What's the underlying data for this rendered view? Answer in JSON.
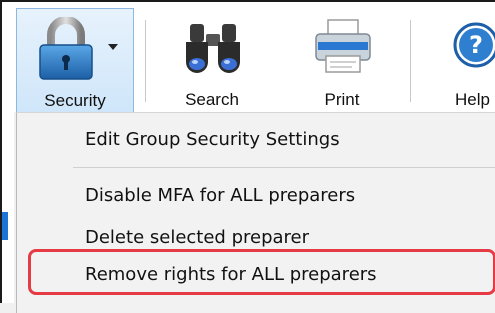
{
  "toolbar": {
    "buttons": [
      {
        "label": "Security",
        "icon": "padlock-icon"
      },
      {
        "label": "Search",
        "icon": "binoculars-icon"
      },
      {
        "label": "Print",
        "icon": "printer-icon"
      },
      {
        "label": "Help",
        "icon": "help-icon"
      }
    ]
  },
  "security_menu": {
    "items": [
      {
        "label": "Edit Group Security Settings"
      },
      {
        "label": "Disable MFA for ALL preparers"
      },
      {
        "label": "Delete selected preparer"
      },
      {
        "label": "Remove rights for ALL preparers"
      }
    ]
  },
  "colors": {
    "highlight": "#e53b45",
    "selected_button": "#cfe6fa",
    "icon_blue": "#2a6fb0"
  }
}
